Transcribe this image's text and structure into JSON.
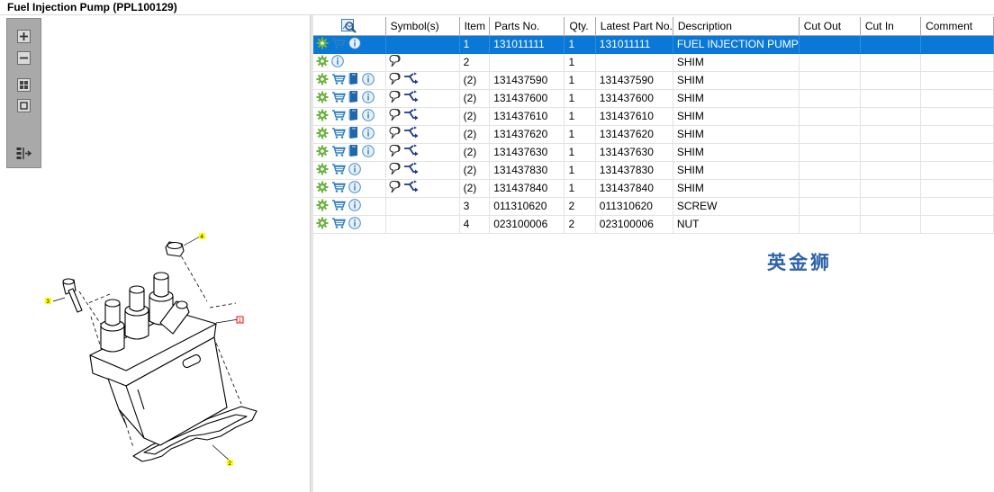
{
  "window": {
    "title": "Fuel Injection Pump (PPL100129)"
  },
  "toolbar": {
    "buttons": [
      {
        "name": "zoom-in-button",
        "icon": "zoom-in-icon"
      },
      {
        "name": "zoom-out-button",
        "icon": "zoom-out-icon"
      },
      {
        "name": "fit-all-button",
        "icon": "fit-all-icon"
      },
      {
        "name": "fit-window-button",
        "icon": "fit-window-icon"
      },
      {
        "name": "show-list-button",
        "icon": "list-arrow-icon"
      }
    ]
  },
  "drawing": {
    "callouts": [
      "4",
      "3",
      "1",
      "2"
    ],
    "colors": {
      "callout_fill": "#ffff00",
      "callout_selected": "#ff0000",
      "line": "#000000"
    }
  },
  "table": {
    "header_icon": "search-image-icon",
    "columns": [
      "Symbol(s)",
      "Item",
      "Parts No.",
      "Qty.",
      "Latest Part No.",
      "Description",
      "Cut Out",
      "Cut In",
      "Comment"
    ],
    "rows": [
      {
        "icons": [
          "gear-icon",
          "cart-icon",
          "info-icon"
        ],
        "symbols": [],
        "item": "1",
        "parts_no": "131011111",
        "qty": "1",
        "latest": "131011111",
        "description": "FUEL INJECTION PUMP",
        "cut_out": "",
        "cut_in": "",
        "comment": "",
        "selected": true
      },
      {
        "icons": [
          "gear-icon",
          "info-icon"
        ],
        "symbols": [
          "balloon-icon"
        ],
        "item": "2",
        "parts_no": "",
        "qty": "1",
        "latest": "",
        "description": "SHIM",
        "cut_out": "",
        "cut_in": "",
        "comment": ""
      },
      {
        "icons": [
          "gear-icon",
          "cart-icon",
          "book-icon",
          "info-icon"
        ],
        "symbols": [
          "balloon-icon",
          "branch-icon"
        ],
        "item": "(2)",
        "parts_no": "131437590",
        "qty": "1",
        "latest": "131437590",
        "description": "SHIM",
        "cut_out": "",
        "cut_in": "",
        "comment": ""
      },
      {
        "icons": [
          "gear-icon",
          "cart-icon",
          "book-icon",
          "info-icon"
        ],
        "symbols": [
          "balloon-icon",
          "branch-icon"
        ],
        "item": "(2)",
        "parts_no": "131437600",
        "qty": "1",
        "latest": "131437600",
        "description": "SHIM",
        "cut_out": "",
        "cut_in": "",
        "comment": ""
      },
      {
        "icons": [
          "gear-icon",
          "cart-icon",
          "book-icon",
          "info-icon"
        ],
        "symbols": [
          "balloon-icon",
          "branch-icon"
        ],
        "item": "(2)",
        "parts_no": "131437610",
        "qty": "1",
        "latest": "131437610",
        "description": "SHIM",
        "cut_out": "",
        "cut_in": "",
        "comment": ""
      },
      {
        "icons": [
          "gear-icon",
          "cart-icon",
          "book-icon",
          "info-icon"
        ],
        "symbols": [
          "balloon-icon",
          "branch-icon"
        ],
        "item": "(2)",
        "parts_no": "131437620",
        "qty": "1",
        "latest": "131437620",
        "description": "SHIM",
        "cut_out": "",
        "cut_in": "",
        "comment": ""
      },
      {
        "icons": [
          "gear-icon",
          "cart-icon",
          "book-icon",
          "info-icon"
        ],
        "symbols": [
          "balloon-icon",
          "branch-icon"
        ],
        "item": "(2)",
        "parts_no": "131437630",
        "qty": "1",
        "latest": "131437630",
        "description": "SHIM",
        "cut_out": "",
        "cut_in": "",
        "comment": ""
      },
      {
        "icons": [
          "gear-icon",
          "cart-icon",
          "info-icon"
        ],
        "symbols": [
          "balloon-icon",
          "branch-icon"
        ],
        "item": "(2)",
        "parts_no": "131437830",
        "qty": "1",
        "latest": "131437830",
        "description": "SHIM",
        "cut_out": "",
        "cut_in": "",
        "comment": ""
      },
      {
        "icons": [
          "gear-icon",
          "cart-icon",
          "info-icon"
        ],
        "symbols": [
          "balloon-icon",
          "branch-icon"
        ],
        "item": "(2)",
        "parts_no": "131437840",
        "qty": "1",
        "latest": "131437840",
        "description": "SHIM",
        "cut_out": "",
        "cut_in": "",
        "comment": ""
      },
      {
        "icons": [
          "gear-icon",
          "cart-icon",
          "info-icon"
        ],
        "symbols": [],
        "item": "3",
        "parts_no": "011310620",
        "qty": "2",
        "latest": "011310620",
        "description": "SCREW",
        "cut_out": "",
        "cut_in": "",
        "comment": ""
      },
      {
        "icons": [
          "gear-icon",
          "cart-icon",
          "info-icon"
        ],
        "symbols": [],
        "item": "4",
        "parts_no": "023100006",
        "qty": "2",
        "latest": "023100006",
        "description": "NUT",
        "cut_out": "",
        "cut_in": "",
        "comment": ""
      }
    ],
    "colors": {
      "selected_row": "#0a78d7",
      "gear": "#6cb33f",
      "cart": "#2a7fc4",
      "info": "#3f88c8",
      "book": "#2166a8",
      "branch": "#1b3a8c"
    }
  },
  "watermark": {
    "text": "英金狮",
    "color": "#2f63a8"
  }
}
